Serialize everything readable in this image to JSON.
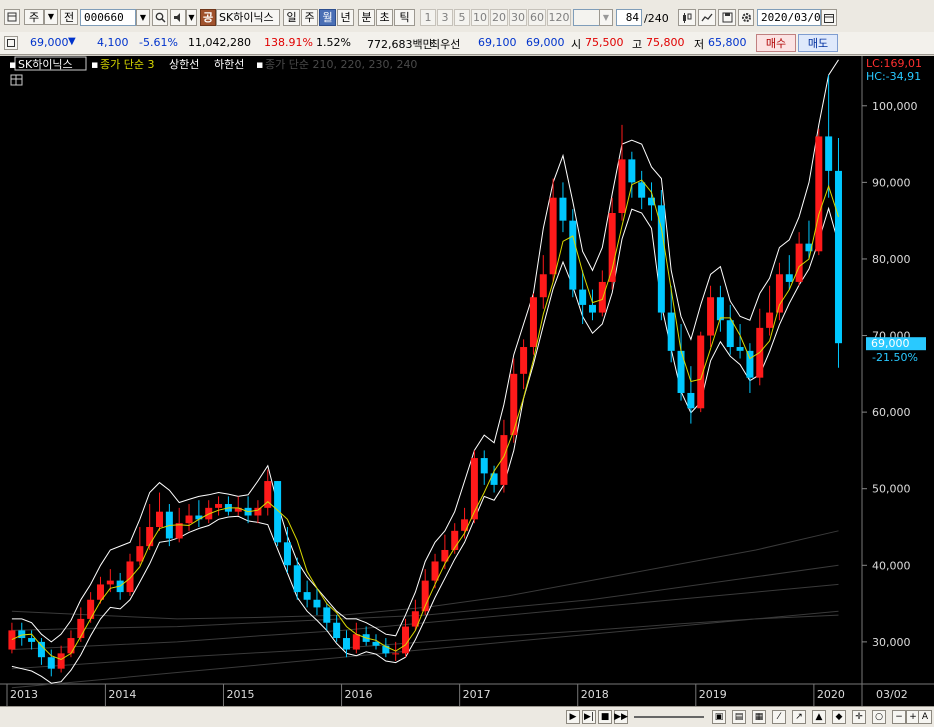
{
  "toolbar": {
    "market": "주",
    "period_toggle": "전",
    "code": "000660",
    "stock_type_badge": "공",
    "stock_name": "SK하이닉스",
    "periods": [
      "일",
      "주",
      "월",
      "년",
      "분",
      "초",
      "틱"
    ],
    "active_period": "월",
    "intervals": [
      "1",
      "3",
      "5",
      "10",
      "20",
      "30",
      "60",
      "120"
    ],
    "count": "84",
    "count_total": "/240",
    "date": "2020/03/02"
  },
  "quote": {
    "price": "69,000",
    "direction": "▼",
    "change": "4,100",
    "change_pct": "-5.61%",
    "volume": "11,042,280",
    "volume_ratio": "138.91%",
    "turnover": "1.52%",
    "amount": "772,683백만",
    "priority_label": "최우선",
    "ask": "69,100",
    "bid": "69,000",
    "open_label": "시",
    "open": "75,500",
    "high_label": "고",
    "high": "75,800",
    "low_label": "저",
    "low": "65,800",
    "buy_button": "매수",
    "sell_button": "매도"
  },
  "chart_legend": {
    "stock": "SK하이닉스",
    "ma_label": "종가 단순 3",
    "upper_band": "상한선",
    "lower_band": "하한선",
    "long_ma": "종가 단순 210, 220, 230, 240"
  },
  "chart_labels": {
    "lc": "LC:169,01",
    "hc": "HC:-34,91",
    "current_price": "69,000",
    "current_change": "-21.50%",
    "date_end": "03/02"
  },
  "colors": {
    "up": "#ff1a1a",
    "down": "#00c8ff",
    "ma": "#d8d800",
    "band": "#ffffff",
    "long_ma": "#3a3a3a",
    "background": "#000000"
  },
  "chart_data": {
    "type": "candlestick",
    "period": "monthly",
    "y_ticks": [
      30000,
      40000,
      50000,
      60000,
      70000,
      80000,
      90000,
      100000
    ],
    "y_tick_labels": [
      "30,000",
      "40,000",
      "50,000",
      "60,000",
      "70,000",
      "80,000",
      "90,000",
      "100,000"
    ],
    "ylim": [
      24500,
      106500
    ],
    "x_year_labels": [
      "2013",
      "2014",
      "2015",
      "2016",
      "2017",
      "2018",
      "2019",
      "2020"
    ],
    "months": [
      "2013-03",
      "2013-04",
      "2013-05",
      "2013-06",
      "2013-07",
      "2013-08",
      "2013-09",
      "2013-10",
      "2013-11",
      "2013-12",
      "2014-01",
      "2014-02",
      "2014-03",
      "2014-04",
      "2014-05",
      "2014-06",
      "2014-07",
      "2014-08",
      "2014-09",
      "2014-10",
      "2014-11",
      "2014-12",
      "2015-01",
      "2015-02",
      "2015-03",
      "2015-04",
      "2015-05",
      "2015-06",
      "2015-07",
      "2015-08",
      "2015-09",
      "2015-10",
      "2015-11",
      "2015-12",
      "2016-01",
      "2016-02",
      "2016-03",
      "2016-04",
      "2016-05",
      "2016-06",
      "2016-07",
      "2016-08",
      "2016-09",
      "2016-10",
      "2016-11",
      "2016-12",
      "2017-01",
      "2017-02",
      "2017-03",
      "2017-04",
      "2017-05",
      "2017-06",
      "2017-07",
      "2017-08",
      "2017-09",
      "2017-10",
      "2017-11",
      "2017-12",
      "2018-01",
      "2018-02",
      "2018-03",
      "2018-04",
      "2018-05",
      "2018-06",
      "2018-07",
      "2018-08",
      "2018-09",
      "2018-10",
      "2018-11",
      "2018-12",
      "2019-01",
      "2019-02",
      "2019-03",
      "2019-04",
      "2019-05",
      "2019-06",
      "2019-07",
      "2019-08",
      "2019-09",
      "2019-10",
      "2019-11",
      "2019-12",
      "2020-01",
      "2020-02",
      "2020-03"
    ],
    "open": [
      29000,
      31500,
      30500,
      30000,
      28000,
      26500,
      28500,
      30500,
      33000,
      35500,
      37500,
      38000,
      36500,
      40500,
      42500,
      45000,
      47000,
      43500,
      45500,
      46500,
      46000,
      47500,
      48000,
      47000,
      47500,
      46500,
      47500,
      51000,
      43000,
      40000,
      36500,
      35500,
      34500,
      32500,
      30500,
      29000,
      31000,
      30000,
      29500,
      28500,
      28500,
      32000,
      34000,
      38000,
      40500,
      42000,
      44500,
      46000,
      54000,
      52000,
      50500,
      57000,
      65000,
      68500,
      75000,
      78000,
      88000,
      85000,
      76000,
      74000,
      73000,
      77000,
      86000,
      93000,
      90000,
      88000,
      87000,
      73000,
      68000,
      62500,
      60500,
      70000,
      75000,
      72000,
      68500,
      68000,
      64500,
      71000,
      73000,
      78000,
      77000,
      82000,
      81000,
      96000,
      91500
    ],
    "close": [
      31500,
      30500,
      30000,
      28000,
      26500,
      28500,
      30500,
      33000,
      35500,
      37500,
      38000,
      36500,
      40500,
      42500,
      45000,
      47000,
      43500,
      45500,
      46500,
      46000,
      47500,
      48000,
      47000,
      47500,
      46500,
      47500,
      51000,
      43000,
      40000,
      36500,
      35500,
      34500,
      32500,
      30500,
      29000,
      31000,
      30000,
      29500,
      28500,
      28500,
      32000,
      34000,
      38000,
      40500,
      42000,
      44500,
      46000,
      54000,
      52000,
      50500,
      57000,
      65000,
      68500,
      75000,
      78000,
      88000,
      85000,
      76000,
      74000,
      73000,
      77000,
      86000,
      93000,
      90000,
      88000,
      87000,
      73000,
      68000,
      62500,
      60500,
      70000,
      75000,
      72000,
      68500,
      68000,
      64500,
      71000,
      73000,
      78000,
      77000,
      82000,
      81000,
      96000,
      91500,
      69000
    ],
    "high": [
      32500,
      32500,
      31500,
      30500,
      29000,
      29500,
      31500,
      34500,
      36500,
      38500,
      39500,
      39000,
      41500,
      45000,
      48000,
      49500,
      48000,
      47500,
      48000,
      48500,
      48500,
      49000,
      49000,
      49000,
      49000,
      48500,
      52500,
      51000,
      45000,
      41000,
      38000,
      37000,
      35000,
      33500,
      31500,
      32500,
      32000,
      31000,
      30500,
      30000,
      33000,
      35500,
      39500,
      41500,
      44000,
      45500,
      47500,
      55000,
      55000,
      53000,
      59000,
      67000,
      69500,
      75500,
      80500,
      90500,
      90000,
      86500,
      78500,
      76000,
      78500,
      88000,
      97500,
      94000,
      91500,
      90000,
      89000,
      76500,
      71500,
      66000,
      70500,
      76500,
      76500,
      74000,
      71500,
      69000,
      73500,
      76500,
      79500,
      80500,
      83500,
      85000,
      97000,
      104000,
      95800
    ],
    "low": [
      28500,
      29500,
      29000,
      27000,
      25500,
      26000,
      28000,
      30000,
      32500,
      35000,
      36500,
      35500,
      36000,
      40000,
      42000,
      44500,
      42500,
      43000,
      44500,
      45000,
      45500,
      46500,
      46500,
      46500,
      45500,
      45500,
      46500,
      42500,
      39000,
      35500,
      34500,
      33500,
      31500,
      30000,
      28000,
      28500,
      29500,
      29000,
      28000,
      27500,
      28000,
      31500,
      33500,
      37000,
      39500,
      41500,
      43500,
      45500,
      50500,
      49500,
      49500,
      56000,
      63000,
      67500,
      73500,
      77000,
      83500,
      75000,
      71500,
      72000,
      72500,
      76000,
      85000,
      88000,
      86500,
      85000,
      72000,
      66500,
      61500,
      58500,
      60000,
      68500,
      70500,
      67500,
      67000,
      62500,
      63500,
      70000,
      72000,
      76000,
      76500,
      80000,
      80500,
      88000,
      65800
    ],
    "upper_band": [
      33000,
      33000,
      32500,
      31000,
      30000,
      31000,
      32800,
      35500,
      37500,
      40000,
      42000,
      42500,
      43000,
      46000,
      49500,
      50800,
      49800,
      48200,
      48600,
      49000,
      49200,
      49500,
      49300,
      49000,
      49200,
      51000,
      53000,
      48000,
      43800,
      40500,
      38500,
      37000,
      35500,
      34000,
      33000,
      33000,
      32500,
      31800,
      31000,
      30800,
      33500,
      36500,
      40500,
      43000,
      44500,
      47000,
      51000,
      55000,
      57000,
      56000,
      61000,
      67500,
      71500,
      75500,
      84000,
      90000,
      93500,
      87500,
      81000,
      78500,
      81500,
      88500,
      95000,
      95500,
      95000,
      92000,
      90500,
      78500,
      72500,
      69500,
      74000,
      78000,
      79000,
      74500,
      72500,
      72000,
      75500,
      77500,
      81500,
      82500,
      85500,
      90000,
      97500,
      104000,
      106000
    ],
    "lower_band": [
      26800,
      26500,
      26200,
      25500,
      24600,
      24800,
      26300,
      28300,
      30800,
      33000,
      34500,
      34300,
      35500,
      37800,
      40200,
      43000,
      43200,
      43600,
      44300,
      44800,
      45200,
      46000,
      46300,
      46400,
      45800,
      45600,
      45300,
      42100,
      39000,
      35800,
      34000,
      32800,
      31500,
      29800,
      28500,
      28200,
      28700,
      28400,
      27500,
      27300,
      28000,
      30300,
      33000,
      35800,
      38300,
      40800,
      43000,
      46000,
      49000,
      48500,
      50500,
      55000,
      61800,
      66200,
      71300,
      76100,
      79600,
      76400,
      72500,
      70300,
      71500,
      75600,
      82600,
      86500,
      86000,
      84000,
      74000,
      68200,
      62700,
      59900,
      61300,
      66700,
      69200,
      67300,
      66200,
      64100,
      64900,
      67900,
      71400,
      74200,
      76600,
      78700,
      82400,
      86600,
      82000
    ],
    "ma3": [
      30300,
      30900,
      31000,
      29500,
      28200,
      27700,
      28500,
      30700,
      33000,
      35300,
      37000,
      37300,
      38300,
      39800,
      42700,
      44800,
      45200,
      45300,
      45200,
      46000,
      46700,
      47200,
      47500,
      47500,
      47000,
      47200,
      48300,
      47200,
      46000,
      43200,
      39200,
      37000,
      35000,
      33800,
      32000,
      31000,
      30500,
      30200,
      29400,
      28800,
      29600,
      31500,
      34700,
      37500,
      40200,
      42300,
      44200,
      47000,
      49500,
      52300,
      54200,
      57600,
      61900,
      66800,
      72800,
      77000,
      82300,
      83000,
      78300,
      74300,
      74700,
      78700,
      84300,
      89700,
      90300,
      88700,
      84000,
      76000,
      68000,
      64000,
      64300,
      68300,
      72300,
      72300,
      70000,
      67000,
      67800,
      69300,
      74000,
      76000,
      79000,
      80000,
      85800,
      89500,
      85500
    ],
    "long_ma": [
      [
        24000,
        25000,
        26000,
        27000,
        28000,
        29000,
        30000,
        31000,
        32000,
        33000,
        34000
      ],
      [
        26500,
        27200,
        28000,
        28600,
        29200,
        30000,
        30800,
        31500,
        32300,
        33000,
        33500
      ],
      [
        29000,
        29500,
        30000,
        30800,
        31500,
        32500,
        33500,
        34500,
        35500,
        36500,
        37500
      ],
      [
        31500,
        31800,
        32000,
        32500,
        33000,
        33500,
        34500,
        35500,
        37000,
        38500,
        40000
      ],
      [
        34000,
        33500,
        33000,
        33200,
        33500,
        34500,
        36000,
        38000,
        40000,
        42000,
        44500
      ]
    ]
  }
}
